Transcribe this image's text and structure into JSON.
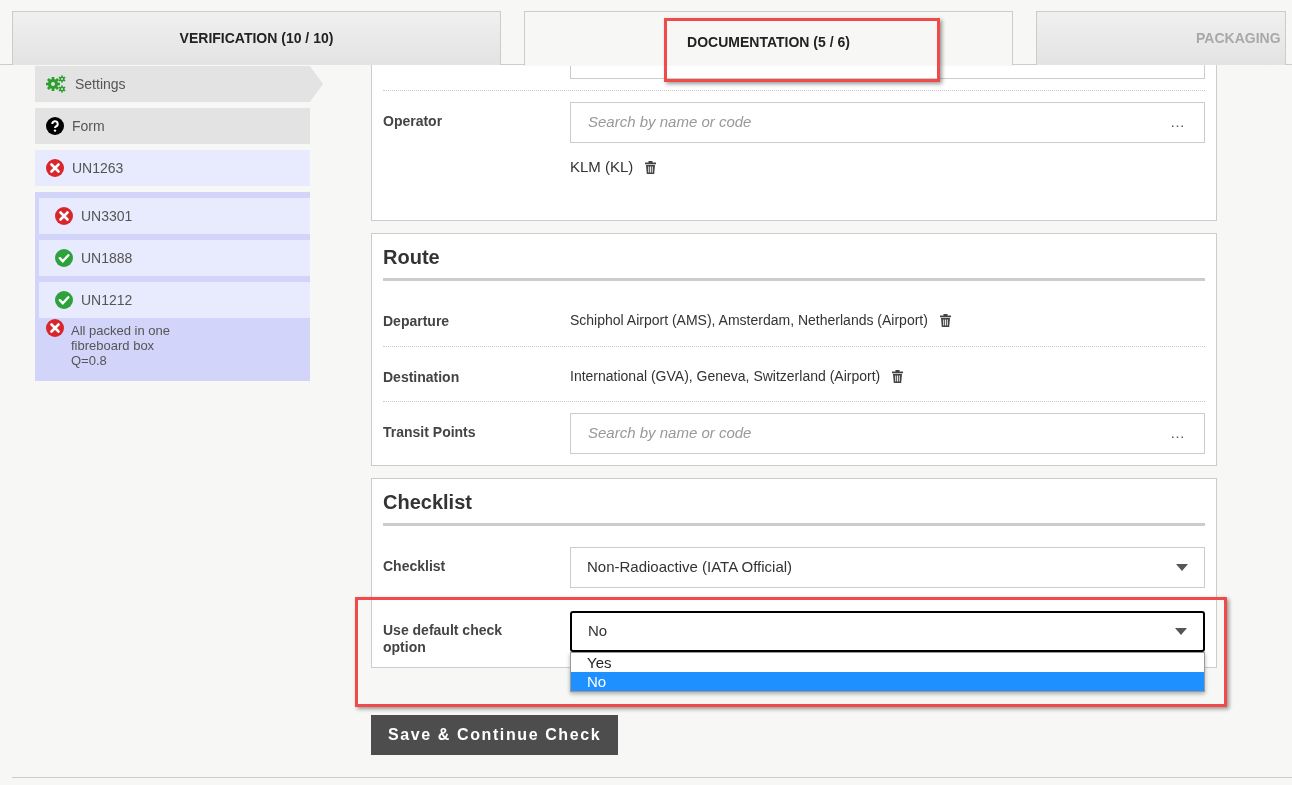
{
  "tabs": [
    {
      "label": "VERIFICATION (10 / 10)",
      "selected": false,
      "highlighted": false,
      "disabled": false
    },
    {
      "label": "DOCUMENTATION (5 / 6)",
      "selected": true,
      "highlighted": true,
      "disabled": false
    },
    {
      "label": "PACKAGING",
      "selected": false,
      "highlighted": false,
      "disabled": true
    }
  ],
  "sidebar": {
    "items": [
      {
        "kind": "settings",
        "label": "Settings",
        "selected": true
      },
      {
        "kind": "help",
        "label": "Form",
        "selected": false
      },
      {
        "kind": "error",
        "label": "UN1263",
        "selected": false
      },
      {
        "kind": "group",
        "children": [
          {
            "kind": "error",
            "label": "UN3301",
            "selected": false
          },
          {
            "kind": "ok",
            "label": "UN1888",
            "selected": false
          },
          {
            "kind": "ok",
            "label": "UN1212",
            "selected": false
          }
        ],
        "note": {
          "kind": "error",
          "label": "All packed in one\nfibreboard box\nQ=0.8"
        }
      }
    ]
  },
  "sections": [
    {
      "rows": [
        {
          "kind": "search",
          "label": "Operator",
          "placeholder": "Search by name or code",
          "more": "…",
          "values": [
            "KLM (KL)"
          ]
        }
      ]
    },
    {
      "title": "Route",
      "rows": [
        {
          "kind": "value",
          "label": "Departure",
          "values": [
            "Schiphol Airport (AMS), Amsterdam, Netherlands (Airport)"
          ]
        },
        {
          "kind": "value",
          "label": "Destination",
          "values": [
            "International (GVA), Geneva, Switzerland (Airport)"
          ]
        },
        {
          "kind": "search",
          "label": "Transit Points",
          "placeholder": "Search by name or code",
          "more": "…"
        }
      ]
    },
    {
      "title": "Checklist",
      "rows": [
        {
          "kind": "select",
          "label": "Checklist",
          "value": "Non-Radioactive (IATA Official)",
          "expanded": false,
          "highlighted": false
        },
        {
          "kind": "select",
          "label": "Use default check option",
          "value": "No",
          "expanded": true,
          "highlighted": true,
          "options": [
            {
              "label": "Yes",
              "selected": false
            },
            {
              "label": "No",
              "selected": true
            }
          ]
        }
      ]
    }
  ],
  "save_button": "Save & Continue Check"
}
